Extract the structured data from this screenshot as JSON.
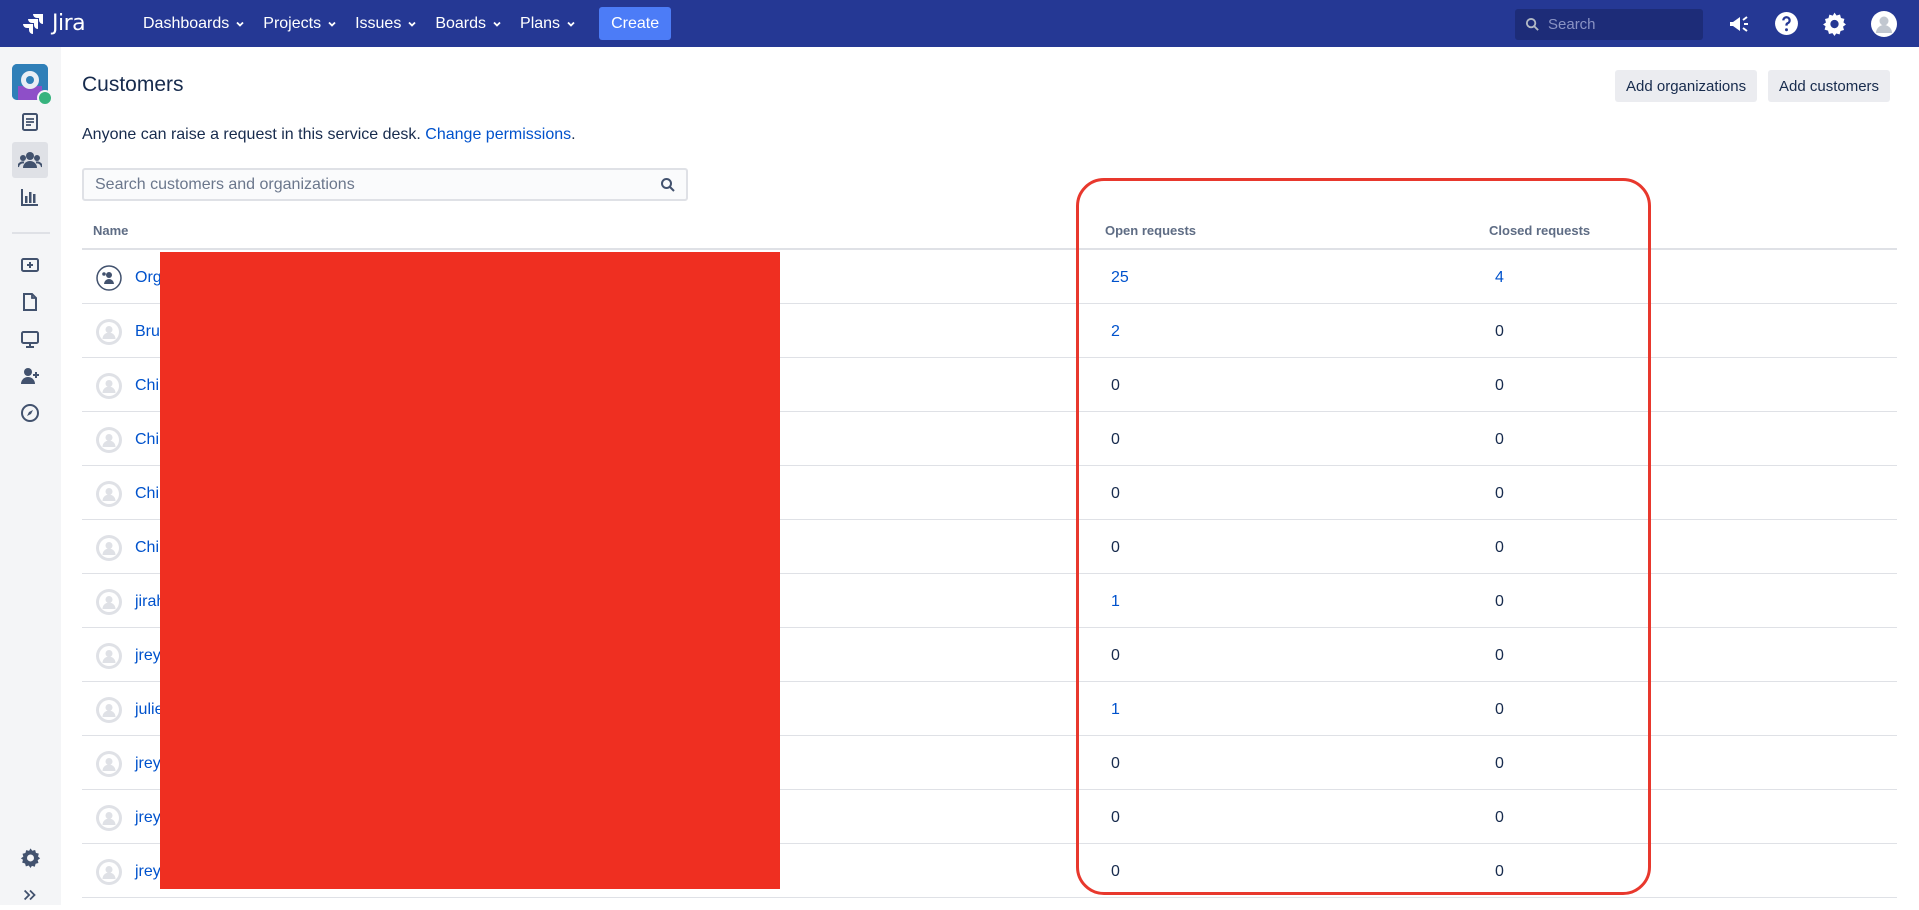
{
  "app": {
    "name": "Jira"
  },
  "topnav": {
    "items": [
      {
        "label": "Dashboards"
      },
      {
        "label": "Projects"
      },
      {
        "label": "Issues"
      },
      {
        "label": "Boards"
      },
      {
        "label": "Plans"
      }
    ],
    "create_label": "Create",
    "search_placeholder": "Search",
    "icons": [
      "megaphone-icon",
      "help-icon",
      "settings-icon",
      "user-avatar"
    ],
    "bg_color": "#253894",
    "create_color": "#4c7cf7"
  },
  "sidebar": {
    "icons": [
      "project-avatar",
      "queues-icon",
      "customers-icon",
      "reports-icon",
      "raise-request-icon",
      "knowledge-base-icon",
      "channels-icon",
      "invite-team-icon",
      "explore-icon",
      "project-settings-icon",
      "expand-sidebar-icon"
    ]
  },
  "page": {
    "title": "Customers",
    "add_organizations_label": "Add organizations",
    "add_customers_label": "Add customers",
    "permission_text": "Anyone can raise a request in this service desk.",
    "change_permissions_label": "Change permissions",
    "permission_suffix": ".",
    "search_placeholder": "Search customers and organizations"
  },
  "table": {
    "headers": {
      "name": "Name",
      "open": "Open requests",
      "closed": "Closed requests"
    },
    "rows": [
      {
        "name": "Org",
        "type": "organization",
        "open": "25",
        "open_link": true,
        "closed": "4",
        "closed_link": true
      },
      {
        "name": "Bru",
        "type": "customer",
        "open": "2",
        "open_link": true,
        "closed": "0",
        "closed_link": false
      },
      {
        "name": "Chi",
        "type": "customer",
        "open": "0",
        "open_link": false,
        "closed": "0",
        "closed_link": false
      },
      {
        "name": "Chi",
        "type": "customer",
        "open": "0",
        "open_link": false,
        "closed": "0",
        "closed_link": false
      },
      {
        "name": "Chi",
        "type": "customer",
        "open": "0",
        "open_link": false,
        "closed": "0",
        "closed_link": false
      },
      {
        "name": "Chi",
        "type": "customer",
        "open": "0",
        "open_link": false,
        "closed": "0",
        "closed_link": false
      },
      {
        "name": "jirah",
        "type": "customer",
        "open": "1",
        "open_link": true,
        "closed": "0",
        "closed_link": false
      },
      {
        "name": "jrey",
        "type": "customer",
        "open": "0",
        "open_link": false,
        "closed": "0",
        "closed_link": false
      },
      {
        "name": "julie",
        "type": "customer",
        "open": "1",
        "open_link": true,
        "closed": "0",
        "closed_link": false
      },
      {
        "name": "jrey",
        "type": "customer",
        "open": "0",
        "open_link": false,
        "closed": "0",
        "closed_link": false
      },
      {
        "name": "jrey",
        "type": "customer",
        "open": "0",
        "open_link": false,
        "closed": "0",
        "closed_link": false
      },
      {
        "name": "jrey",
        "type": "customer",
        "open": "0",
        "open_link": false,
        "closed": "0",
        "closed_link": false
      }
    ]
  },
  "colors": {
    "link": "#0052cc",
    "redaction": "#ef2f21",
    "highlight": "#e8382d"
  }
}
